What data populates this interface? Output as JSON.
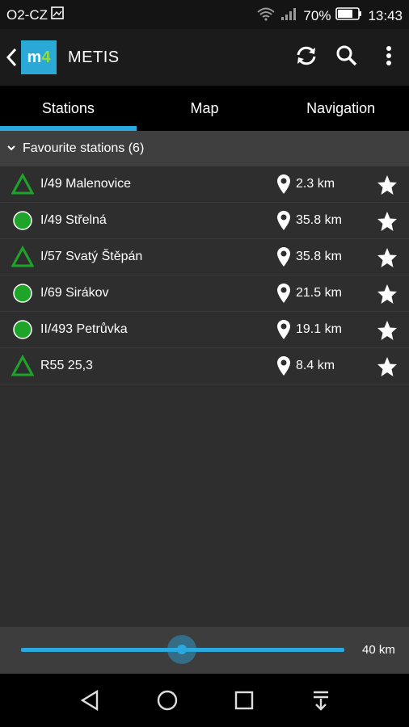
{
  "status_bar": {
    "carrier": "O2-CZ",
    "battery": "70%",
    "time": "13:43"
  },
  "app_bar": {
    "title": "METIS",
    "logo_text": "m4"
  },
  "tabs": [
    {
      "label": "Stations",
      "active": true
    },
    {
      "label": "Map",
      "active": false
    },
    {
      "label": "Navigation",
      "active": false
    }
  ],
  "section": {
    "label": "Favourite stations (6)"
  },
  "stations": [
    {
      "name": "I/49 Malenovice",
      "distance": "2.3 km",
      "icon": "triangle-icon"
    },
    {
      "name": "I/49 Střelná",
      "distance": "35.8 km",
      "icon": "circle-icon"
    },
    {
      "name": "I/57 Svatý Štěpán",
      "distance": "35.8 km",
      "icon": "triangle-icon"
    },
    {
      "name": "I/69 Sirákov",
      "distance": "21.5 km",
      "icon": "circle-icon"
    },
    {
      "name": "II/493 Petrůvka",
      "distance": "19.1 km",
      "icon": "circle-icon"
    },
    {
      "name": "R55 25,3",
      "distance": "8.4 km",
      "icon": "triangle-icon"
    }
  ],
  "range": {
    "label": "40 km"
  },
  "colors": {
    "accent": "#2aa9e0",
    "station_green": "#1fa42a"
  }
}
